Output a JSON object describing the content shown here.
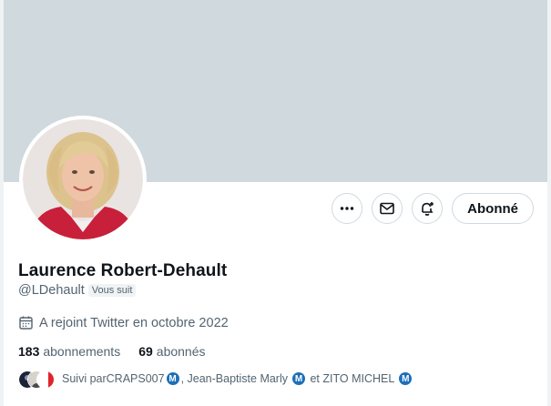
{
  "profile": {
    "name": "Laurence Robert-Dehault",
    "handle": "@LDehault",
    "follows_you_badge": "Vous suit",
    "joined": "A rejoint Twitter en octobre 2022"
  },
  "actions": {
    "follow_label": "Abonné"
  },
  "stats": {
    "following_count": "183",
    "following_label": "abonnements",
    "followers_count": "69",
    "followers_label": "abonnés"
  },
  "followed_by": {
    "prefix": "Suivi par ",
    "user1": "CRAPS007",
    "sep1": ", ",
    "user2": "Jean-Baptiste Marly",
    "sep2": " et ",
    "user3": "ZITO MICHEL",
    "badge_letter": "M"
  },
  "icons": [
    "more-icon",
    "mail-icon",
    "bell-plus-icon",
    "calendar-icon",
    "m-badge-icon"
  ],
  "colors": {
    "banner": "#cfd9de",
    "text_primary": "#0f1419",
    "text_secondary": "#536471",
    "badge_blue": "#1d6fb8"
  }
}
